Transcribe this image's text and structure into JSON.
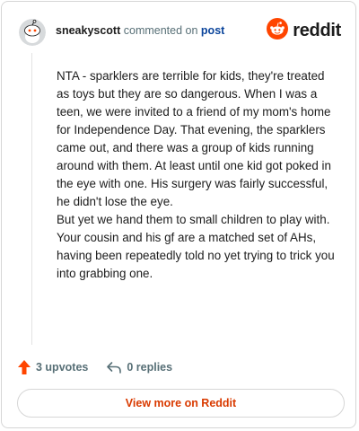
{
  "header": {
    "username": "sneakyscott",
    "verb": "commented on",
    "post_link": "post",
    "brand": "reddit"
  },
  "comment": {
    "paragraphs": [
      "NTA - sparklers are terrible for kids, they're treated as toys but they are so dangerous. When I was a teen, we were invited to a friend of my mom's home for Independence Day. That evening, the sparklers came out, and there was a group of kids running around with them. At least until one kid got poked in the eye with one. His surgery was fairly successful, he didn't lose the eye.",
      "But yet we hand them to small children to play with.",
      "Your cousin and his gf are a matched set of AHs, having been repeatedly told no yet trying to trick you into grabbing one."
    ]
  },
  "actions": {
    "upvotes": "3 upvotes",
    "replies": "0 replies"
  },
  "footer": {
    "view_more": "View more on Reddit"
  },
  "colors": {
    "brand_orange": "#ff4500",
    "upvote": "#ff4500",
    "link_blue": "#0a449b",
    "button_text": "#d93a00",
    "muted": "#576f76"
  },
  "icons": [
    "snoo-avatar-icon",
    "reddit-logo-icon",
    "upvote-arrow-icon",
    "reply-arrow-icon"
  ]
}
